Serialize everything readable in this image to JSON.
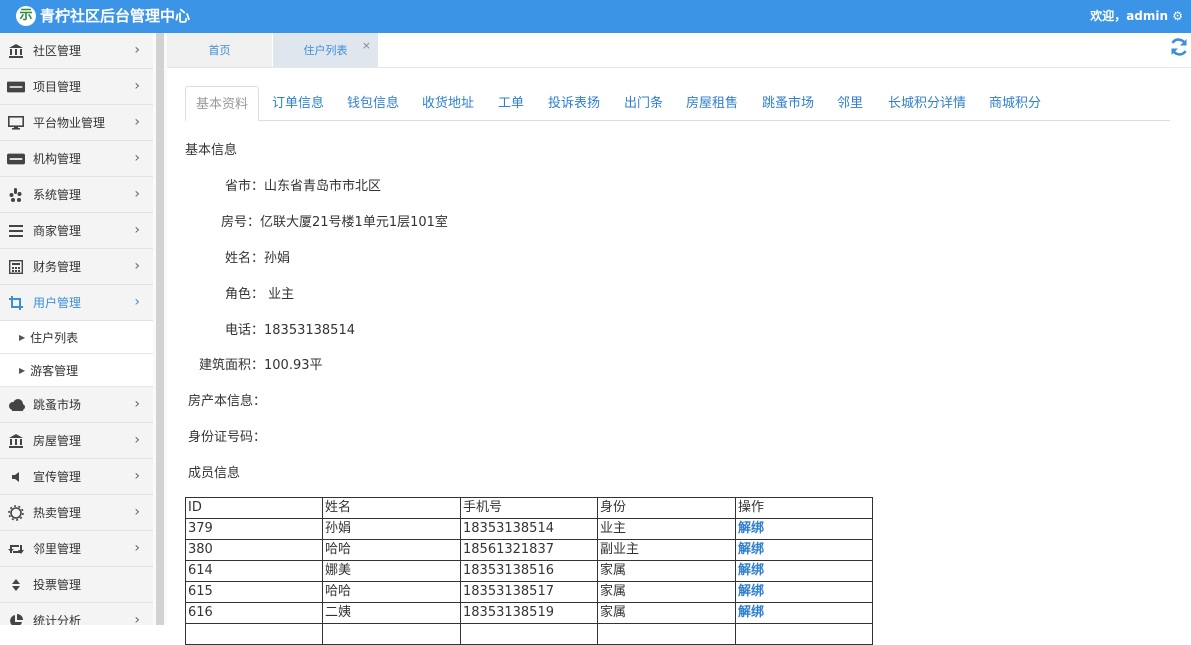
{
  "header": {
    "logo_glyph": "示",
    "title": "青柠社区后台管理中心",
    "welcome": "欢迎，admin",
    "settings_glyph": "⚙",
    "bg_color": "#3b94e6"
  },
  "sidebar": {
    "items": [
      {
        "label": "社区管理",
        "icon": "bank-icon"
      },
      {
        "label": "项目管理",
        "icon": "discover-card-icon"
      },
      {
        "label": "平台物业管理",
        "icon": "desktop-icon"
      },
      {
        "label": "机构管理",
        "icon": "stripe-icon"
      },
      {
        "label": "系统管理",
        "icon": "yelp-icon"
      },
      {
        "label": "商家管理",
        "icon": "bars-icon"
      },
      {
        "label": "财务管理",
        "icon": "calculator-icon"
      },
      {
        "label": "用户管理",
        "icon": "crop-icon",
        "active": true
      },
      {
        "label": "跳蚤市场",
        "icon": "cloud-icon"
      },
      {
        "label": "房屋管理",
        "icon": "bank-icon"
      },
      {
        "label": "宣传管理",
        "icon": "volume-icon"
      },
      {
        "label": "热卖管理",
        "icon": "gear-icon"
      },
      {
        "label": "邻里管理",
        "icon": "retweet-icon"
      },
      {
        "label": "投票管理",
        "icon": "sort-icon"
      },
      {
        "label": "统计分析",
        "icon": "pie-chart-icon"
      }
    ],
    "subitems": [
      {
        "label": "住户列表"
      },
      {
        "label": "游客管理"
      }
    ],
    "chevron": "›",
    "active_color": "#3b8fd9"
  },
  "page_tabs": {
    "home": "首页",
    "list": "住户列表",
    "close": "×",
    "refresh_glyph": "⟳"
  },
  "sub_tabs": [
    "基本资料",
    "订单信息",
    "钱包信息",
    "收货地址",
    "工单",
    "投诉表扬",
    "出门条",
    "房屋租售",
    "跳蚤市场",
    "邻里",
    "长城积分详情",
    "商城积分"
  ],
  "info": {
    "section_title": "基本信息",
    "province_label": "省市：",
    "province_value": "山东省青岛市市北区",
    "room_label": "房号：",
    "room_value": "亿联大厦21号楼1单元1层101室",
    "name_label": "姓名：",
    "name_value": "孙娟",
    "role_label": "角色：",
    "role_value": " 业主",
    "phone_label": "电话：",
    "phone_value": "18353138514",
    "area_label": "建筑面积：",
    "area_value": "100.93平",
    "deed_label": "房产本信息：",
    "id_label": "身份证号码：",
    "members_title": "成员信息"
  },
  "members": {
    "headers": [
      "ID",
      "姓名",
      "手机号",
      "身份",
      "操作"
    ],
    "rows": [
      {
        "id": "379",
        "name": "孙娟",
        "phone": "18353138514",
        "role": "业主",
        "action": "解绑"
      },
      {
        "id": "380",
        "name": "哈哈",
        "phone": "18561321837",
        "role": "副业主",
        "action": "解绑"
      },
      {
        "id": "614",
        "name": "娜美",
        "phone": "18353138516",
        "role": "家属",
        "action": "解绑"
      },
      {
        "id": "615",
        "name": "哈哈",
        "phone": "18353138517",
        "role": "家属",
        "action": "解绑"
      },
      {
        "id": "616",
        "name": "二姨",
        "phone": "18353138519",
        "role": "家属",
        "action": "解绑"
      }
    ]
  }
}
